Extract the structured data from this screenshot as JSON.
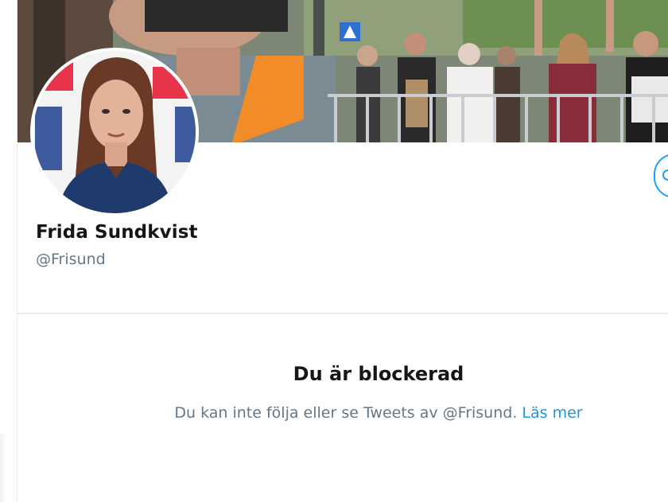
{
  "profile": {
    "display_name": "Frida Sundkvist",
    "handle": "@Frisund"
  },
  "blocked": {
    "title": "Du är blockerad",
    "message": "Du kan inte följa eller se Tweets av @Frisund.",
    "link_label": "Läs mer"
  },
  "icons": {
    "follow_button": "circle-icon"
  },
  "colors": {
    "accent": "#1da1f2",
    "link": "#1b95e0",
    "text_primary": "#14171a",
    "text_secondary": "#657786",
    "divider": "#e6ecf0"
  }
}
